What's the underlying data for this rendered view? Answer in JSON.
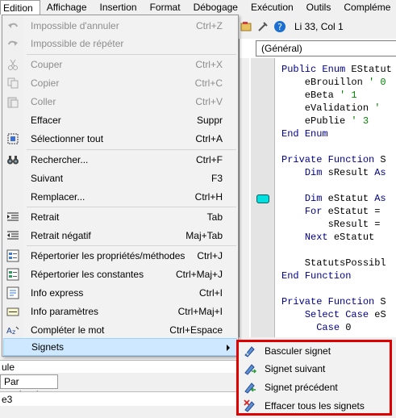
{
  "menubar": {
    "items": [
      "Edition",
      "Affichage",
      "Insertion",
      "Format",
      "Débogage",
      "Exécution",
      "Outils",
      "Compléme"
    ]
  },
  "toolbar": {
    "position": "Li 33, Col 1"
  },
  "code_window": {
    "procedure_combo": "(Général)",
    "lines": [
      "Public Enum EStatut",
      "    eBrouillon ' 0",
      "    eBeta ' 1",
      "    eValidation '",
      "    ePublie ' 3",
      "End Enum",
      "",
      "Private Function S",
      "    Dim sResult As",
      "",
      "    Dim eStatut As",
      "    For eStatut =",
      "        sResult =",
      "    Next eStatut",
      "",
      "    StatutsPossibl",
      "End Function",
      "",
      "Private Function S",
      "    Select Case eS",
      "      Case 0"
    ]
  },
  "bottom_panel": {
    "row1": "ule",
    "tab": "Par catégorie",
    "row2": "e3"
  },
  "edit_menu": {
    "items": [
      {
        "label": "Impossible d'annuler",
        "shortcut": "Ctrl+Z",
        "icon": "undo-icon"
      },
      {
        "label": "Impossible de répéter",
        "shortcut": "",
        "icon": "redo-icon"
      },
      {
        "label": "Couper",
        "shortcut": "Ctrl+X",
        "icon": "cut-icon"
      },
      {
        "label": "Copier",
        "shortcut": "Ctrl+C",
        "icon": "copy-icon"
      },
      {
        "label": "Coller",
        "shortcut": "Ctrl+V",
        "icon": "paste-icon"
      },
      {
        "label": "Effacer",
        "shortcut": "Suppr",
        "icon": ""
      },
      {
        "label": "Sélectionner tout",
        "shortcut": "Ctrl+A",
        "icon": "select-all-icon"
      },
      {
        "label": "Rechercher...",
        "shortcut": "Ctrl+F",
        "icon": "binoculars-icon"
      },
      {
        "label": "Suivant",
        "shortcut": "F3",
        "icon": ""
      },
      {
        "label": "Remplacer...",
        "shortcut": "Ctrl+H",
        "icon": ""
      },
      {
        "label": "Retrait",
        "shortcut": "Tab",
        "icon": "indent-icon"
      },
      {
        "label": "Retrait négatif",
        "shortcut": "Maj+Tab",
        "icon": "outdent-icon"
      },
      {
        "label": "Répertorier les propriétés/méthodes",
        "shortcut": "Ctrl+J",
        "icon": "list-members-icon"
      },
      {
        "label": "Répertorier les constantes",
        "shortcut": "Ctrl+Maj+J",
        "icon": "list-constants-icon"
      },
      {
        "label": "Info express",
        "shortcut": "Ctrl+I",
        "icon": "quick-info-icon"
      },
      {
        "label": "Info paramètres",
        "shortcut": "Ctrl+Maj+I",
        "icon": "parameter-info-icon"
      },
      {
        "label": "Compléter le mot",
        "shortcut": "Ctrl+Espace",
        "icon": "complete-word-icon"
      },
      {
        "label": "Signets",
        "shortcut": "",
        "icon": ""
      }
    ]
  },
  "bookmarks_submenu": {
    "items": [
      {
        "label": "Basculer signet",
        "icon": "toggle-bookmark-icon"
      },
      {
        "label": "Signet suivant",
        "icon": "next-bookmark-icon"
      },
      {
        "label": "Signet précédent",
        "icon": "previous-bookmark-icon"
      },
      {
        "label": "Effacer tous les signets",
        "icon": "clear-bookmarks-icon"
      }
    ]
  },
  "colors": {
    "highlight": "#cde8ff",
    "bookmark": "#00e0e0",
    "submenu_border": "#e00000",
    "keyword": "#00008b",
    "comment": "#008000"
  }
}
